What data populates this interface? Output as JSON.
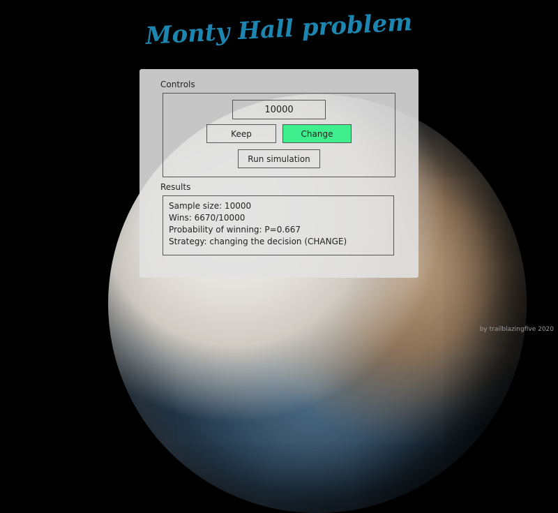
{
  "title": "Monty Hall problem",
  "controls": {
    "label": "Controls",
    "sample_input_value": "10000",
    "keep_label": "Keep",
    "change_label": "Change",
    "run_label": "Run simulation",
    "active_strategy": "Change",
    "active_color": "#3fef8e"
  },
  "results": {
    "label": "Results",
    "lines": [
      "Sample size: 10000",
      "Wins: 6670/10000",
      "Probability of winning: P=0.667",
      "Strategy: changing the decision (CHANGE)"
    ]
  },
  "credit": "by trailblazingfive 2020",
  "background": "planet-image"
}
